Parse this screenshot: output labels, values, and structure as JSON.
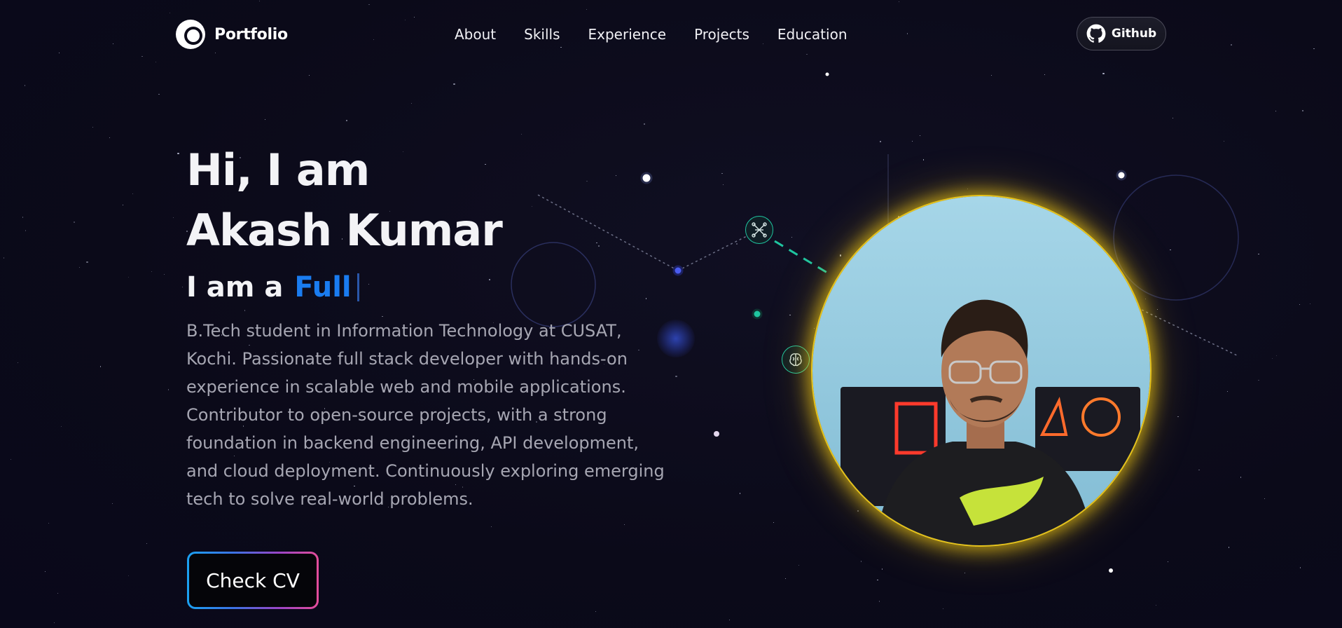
{
  "brand": {
    "name": "Portfolio",
    "logo_icon": "portfolio-logo-icon"
  },
  "nav": {
    "links": [
      "About",
      "Skills",
      "Experience",
      "Projects",
      "Education"
    ],
    "github_label": "Github",
    "github_icon": "github-icon"
  },
  "hero": {
    "greeting": "Hi, I am",
    "name": "Akash Kumar",
    "typing_prefix": "I am a",
    "typing_role": "Full",
    "bio": "B.Tech student in Information Technology at CUSAT, Kochi. Passionate full stack developer with hands-on experience in scalable web and mobile applications. Contributor to open-source projects, with a strong foundation in backend engineering, API development, and cloud deployment. Continuously exploring emerging tech to solve real-world problems.",
    "cv_button": "Check CV"
  },
  "profile": {
    "photo_alt": "profile photo",
    "ring_color": "#e6c21a"
  },
  "colors": {
    "background": "#0b0a19",
    "accent_blue": "#1a7cf0",
    "teal": "#1fc5a0",
    "cv_gradient": [
      "#1ba1f2",
      "#e44d9a"
    ]
  }
}
